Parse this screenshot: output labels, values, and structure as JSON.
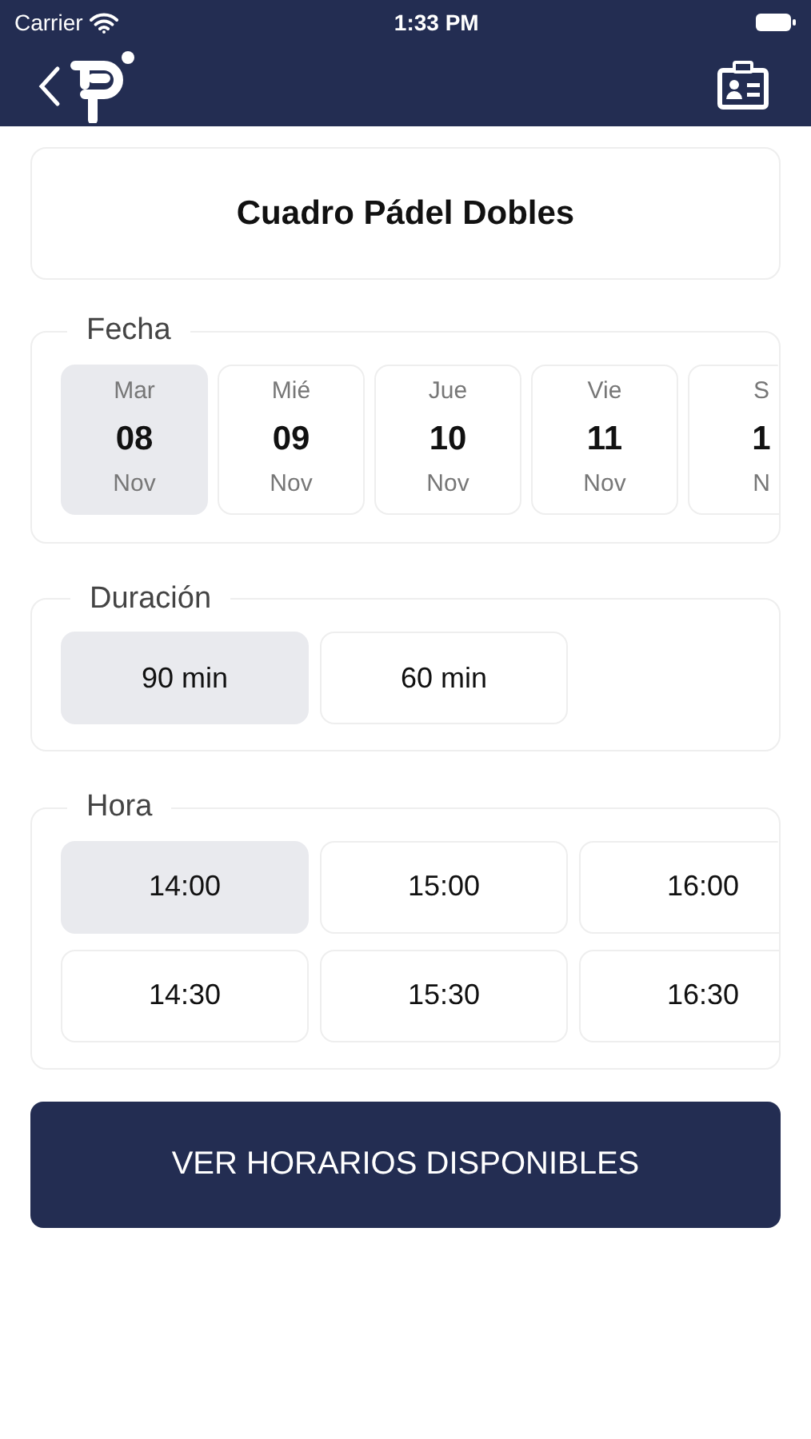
{
  "status_bar": {
    "carrier": "Carrier",
    "time": "1:33 PM"
  },
  "title": "Cuadro Pádel Dobles",
  "dates": {
    "legend": "Fecha",
    "items": [
      {
        "weekday": "Mar",
        "day": "08",
        "month": "Nov",
        "selected": true
      },
      {
        "weekday": "Mié",
        "day": "09",
        "month": "Nov",
        "selected": false
      },
      {
        "weekday": "Jue",
        "day": "10",
        "month": "Nov",
        "selected": false
      },
      {
        "weekday": "Vie",
        "day": "11",
        "month": "Nov",
        "selected": false
      },
      {
        "weekday": "S",
        "day": "1",
        "month": "N",
        "selected": false
      }
    ]
  },
  "durations": {
    "legend": "Duración",
    "items": [
      {
        "label": "90 min",
        "selected": true
      },
      {
        "label": "60 min",
        "selected": false
      }
    ]
  },
  "times": {
    "legend": "Hora",
    "items": [
      {
        "label": "14:00",
        "selected": true
      },
      {
        "label": "15:00",
        "selected": false
      },
      {
        "label": "16:00",
        "selected": false
      },
      {
        "label": "14:30",
        "selected": false
      },
      {
        "label": "15:30",
        "selected": false
      },
      {
        "label": "16:30",
        "selected": false
      }
    ]
  },
  "action_button": "VER HORARIOS DISPONIBLES"
}
